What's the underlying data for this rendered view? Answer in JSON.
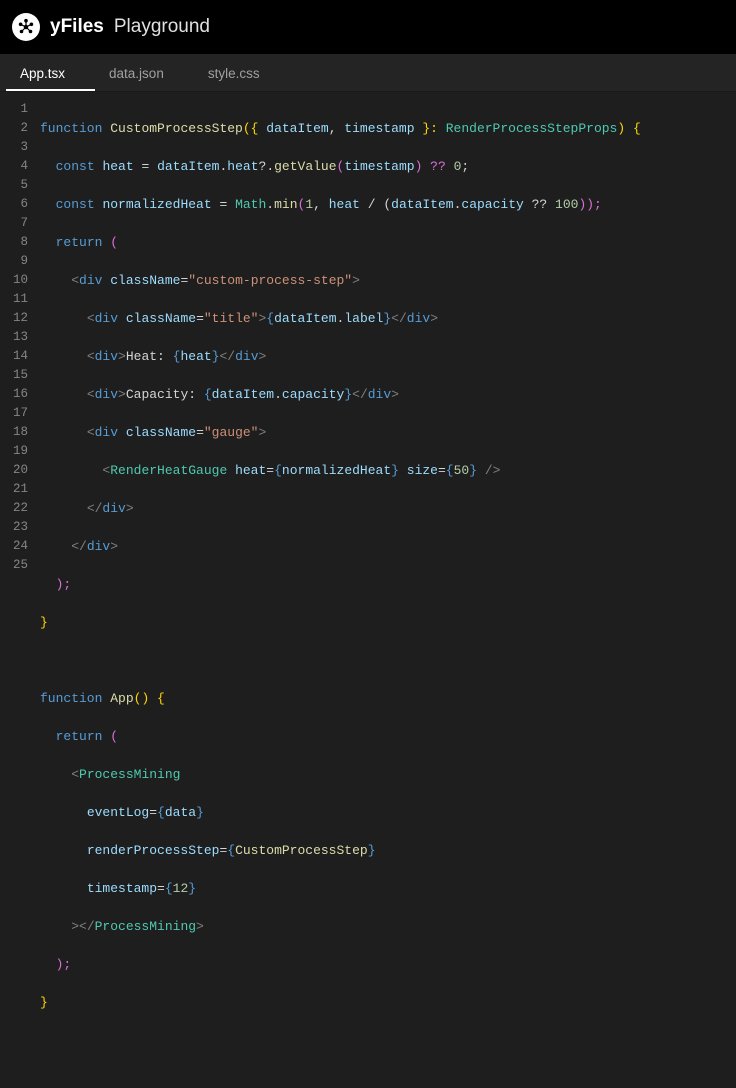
{
  "header": {
    "brand": "yFiles",
    "title": "Playground",
    "logo_icon": "asterisk-nodes"
  },
  "tabs": [
    {
      "label": "App.tsx",
      "active": true
    },
    {
      "label": "data.json",
      "active": false
    },
    {
      "label": "style.css",
      "active": false
    }
  ],
  "line_count": 25,
  "code": {
    "t1_k1": "function",
    "t1_fn": "CustomProcessStep",
    "t1_p1": "({ ",
    "t1_v1": "dataItem",
    "t1_p2": ", ",
    "t1_v2": "timestamp",
    "t1_p3": " }: ",
    "t1_ty": "RenderProcessStepProps",
    "t1_p4": ") {",
    "t2_k1": "const",
    "t2_v1": "heat",
    "t2_p1": " = ",
    "t2_v2": "dataItem",
    "t2_p2": ".",
    "t2_v3": "heat",
    "t2_p3": "?.",
    "t2_fn": "getValue",
    "t2_p4": "(",
    "t2_v4": "timestamp",
    "t2_p5": ") ?? ",
    "t2_n": "0",
    "t2_p6": ";",
    "t3_k1": "const",
    "t3_v1": "normalizedHeat",
    "t3_p1": " = ",
    "t3_ty": "Math",
    "t3_p2": ".",
    "t3_fn": "min",
    "t3_p3": "(",
    "t3_n1": "1",
    "t3_p4": ", ",
    "t3_v2": "heat",
    "t3_p5": " / (",
    "t3_v3": "dataItem",
    "t3_p6": ".",
    "t3_v4": "capacity",
    "t3_p7": " ?? ",
    "t3_n2": "100",
    "t3_p8": "));",
    "t4_k": "return",
    "t4_p": " (",
    "t5_o": "<",
    "t5_el": "div",
    "t5_a": "className",
    "t5_eq": "=",
    "t5_s": "\"custom-process-step\"",
    "t5_c": ">",
    "t6_o": "<",
    "t6_el": "div",
    "t6_a": "className",
    "t6_eq": "=",
    "t6_s": "\"title\"",
    "t6_c1": ">",
    "t6_bo": "{",
    "t6_v1": "dataItem",
    "t6_p": ".",
    "t6_v2": "label",
    "t6_bc": "}",
    "t6_c2": "</",
    "t6_el2": "div",
    "t6_c3": ">",
    "t7_o": "<",
    "t7_el": "div",
    "t7_c1": ">",
    "t7_txt": "Heat: ",
    "t7_bo": "{",
    "t7_v": "heat",
    "t7_bc": "}",
    "t7_c2": "</",
    "t7_el2": "div",
    "t7_c3": ">",
    "t8_o": "<",
    "t8_el": "div",
    "t8_c1": ">",
    "t8_txt": "Capacity: ",
    "t8_bo": "{",
    "t8_v1": "dataItem",
    "t8_p": ".",
    "t8_v2": "capacity",
    "t8_bc": "}",
    "t8_c2": "</",
    "t8_el2": "div",
    "t8_c3": ">",
    "t9_o": "<",
    "t9_el": "div",
    "t9_a": "className",
    "t9_eq": "=",
    "t9_s": "\"gauge\"",
    "t9_c": ">",
    "t10_o": "<",
    "t10_comp": "RenderHeatGauge",
    "t10_a1": "heat",
    "t10_eq": "=",
    "t10_bo1": "{",
    "t10_v": "normalizedHeat",
    "t10_bc1": "}",
    "t10_a2": "size",
    "t10_bo2": "{",
    "t10_n": "50",
    "t10_bc2": "}",
    "t10_c": " />",
    "t11_c1": "</",
    "t11_el": "div",
    "t11_c2": ">",
    "t12_c1": "</",
    "t12_el": "div",
    "t12_c2": ">",
    "t13": ");",
    "t14": "}",
    "t16_k": "function",
    "t16_fn": "App",
    "t16_p": "() {",
    "t17_k": "return",
    "t17_p": " (",
    "t18_o": "<",
    "t18_comp": "ProcessMining",
    "t19_a": "eventLog",
    "t19_eq": "=",
    "t19_bo": "{",
    "t19_v": "data",
    "t19_bc": "}",
    "t20_a": "renderProcessStep",
    "t20_eq": "=",
    "t20_bo": "{",
    "t20_v": "CustomProcessStep",
    "t20_bc": "}",
    "t21_a": "timestamp",
    "t21_eq": "=",
    "t21_bo": "{",
    "t21_n": "12",
    "t21_bc": "}",
    "t22_c1": "></",
    "t22_comp": "ProcessMining",
    "t22_c2": ">",
    "t23": ");",
    "t24": "}"
  }
}
